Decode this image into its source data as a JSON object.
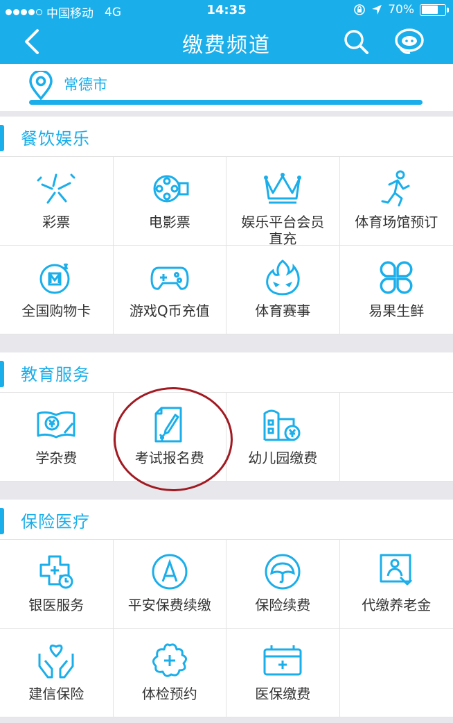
{
  "status_bar": {
    "carrier": "中国移动",
    "network": "4G",
    "time": "14:35",
    "battery": "70%",
    "battery_level": 0.7
  },
  "navbar": {
    "title": "缴费频道"
  },
  "location": {
    "city": "常德市"
  },
  "sections": [
    {
      "title": "餐饮娱乐",
      "items": [
        {
          "label": "彩票",
          "icon": "lottery-icon"
        },
        {
          "label": "电影票",
          "icon": "film-reel-icon"
        },
        {
          "label": "娱乐平台会员直充",
          "icon": "crown-icon"
        },
        {
          "label": "体育场馆预订",
          "icon": "running-person-icon"
        },
        {
          "label": "全国购物卡",
          "icon": "shopping-card-icon"
        },
        {
          "label": "游戏Q币充值",
          "icon": "gamepad-icon"
        },
        {
          "label": "体育赛事",
          "icon": "flame-mask-icon"
        },
        {
          "label": "易果生鲜",
          "icon": "fruit-grid-icon"
        }
      ]
    },
    {
      "title": "教育服务",
      "items": [
        {
          "label": "学杂费",
          "icon": "book-yen-icon"
        },
        {
          "label": "考试报名费",
          "icon": "exam-paper-icon"
        },
        {
          "label": "幼儿园缴费",
          "icon": "kindergarten-icon"
        }
      ]
    },
    {
      "title": "保险医疗",
      "items": [
        {
          "label": "银医服务",
          "icon": "medical-cross-clock-icon"
        },
        {
          "label": "平安保费续缴",
          "icon": "pingan-a-icon"
        },
        {
          "label": "保险续费",
          "icon": "umbrella-icon"
        },
        {
          "label": "代缴养老金",
          "icon": "pension-icon"
        },
        {
          "label": "建信保险",
          "icon": "hands-heart-icon"
        },
        {
          "label": "体检预约",
          "icon": "health-check-icon"
        },
        {
          "label": "医保缴费",
          "icon": "medical-kit-icon"
        }
      ]
    }
  ],
  "colors": {
    "accent": "#1aaeea",
    "highlight_circle": "#a11a22"
  }
}
